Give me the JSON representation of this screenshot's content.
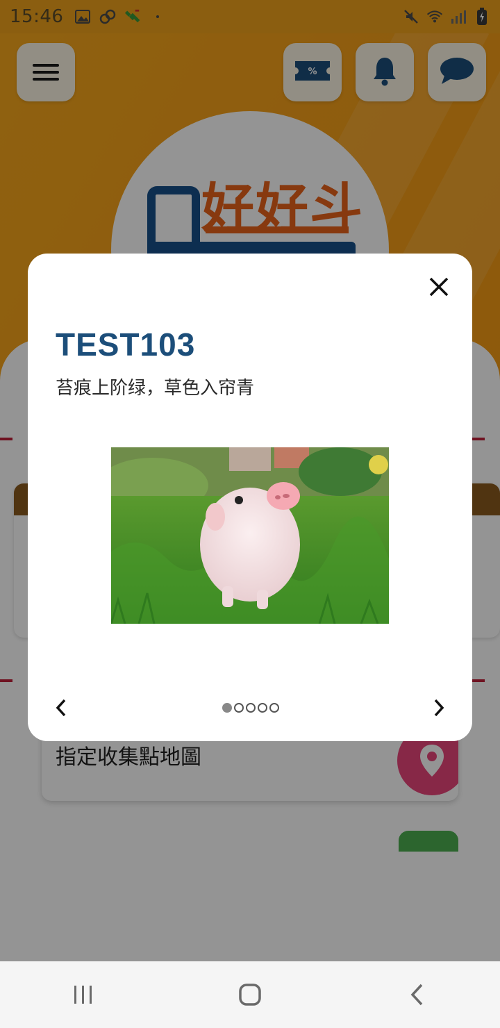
{
  "status_bar": {
    "time": "15:46",
    "left_icons": [
      "image-icon",
      "link-icon",
      "satellite-icon",
      "dot-icon"
    ],
    "right_icons": [
      "mute-icon",
      "wifi-icon",
      "signal-icon",
      "battery-charging-icon"
    ]
  },
  "header": {
    "icons": [
      "hamburger-menu-icon",
      "coupon-ticket-icon",
      "bell-icon",
      "chat-bubble-icon"
    ],
    "logo_text": "好好斗"
  },
  "background": {
    "map_card_label": "指定收集點地圖"
  },
  "modal": {
    "title": "TEST103",
    "subtitle": "苔痕上阶绿，草色入帘青",
    "image_subject": "piglet-on-grass",
    "pagination": {
      "current": 1,
      "total": 5
    }
  },
  "nav_bar": {
    "buttons": [
      "recents-icon",
      "home-icon",
      "back-icon"
    ]
  },
  "colors": {
    "header_orange": "#f6a11a",
    "title_blue": "#1c4e7a",
    "logo_orange": "#e8621a",
    "logo_blue": "#17508a",
    "map_badge_pink": "#e8457a"
  }
}
